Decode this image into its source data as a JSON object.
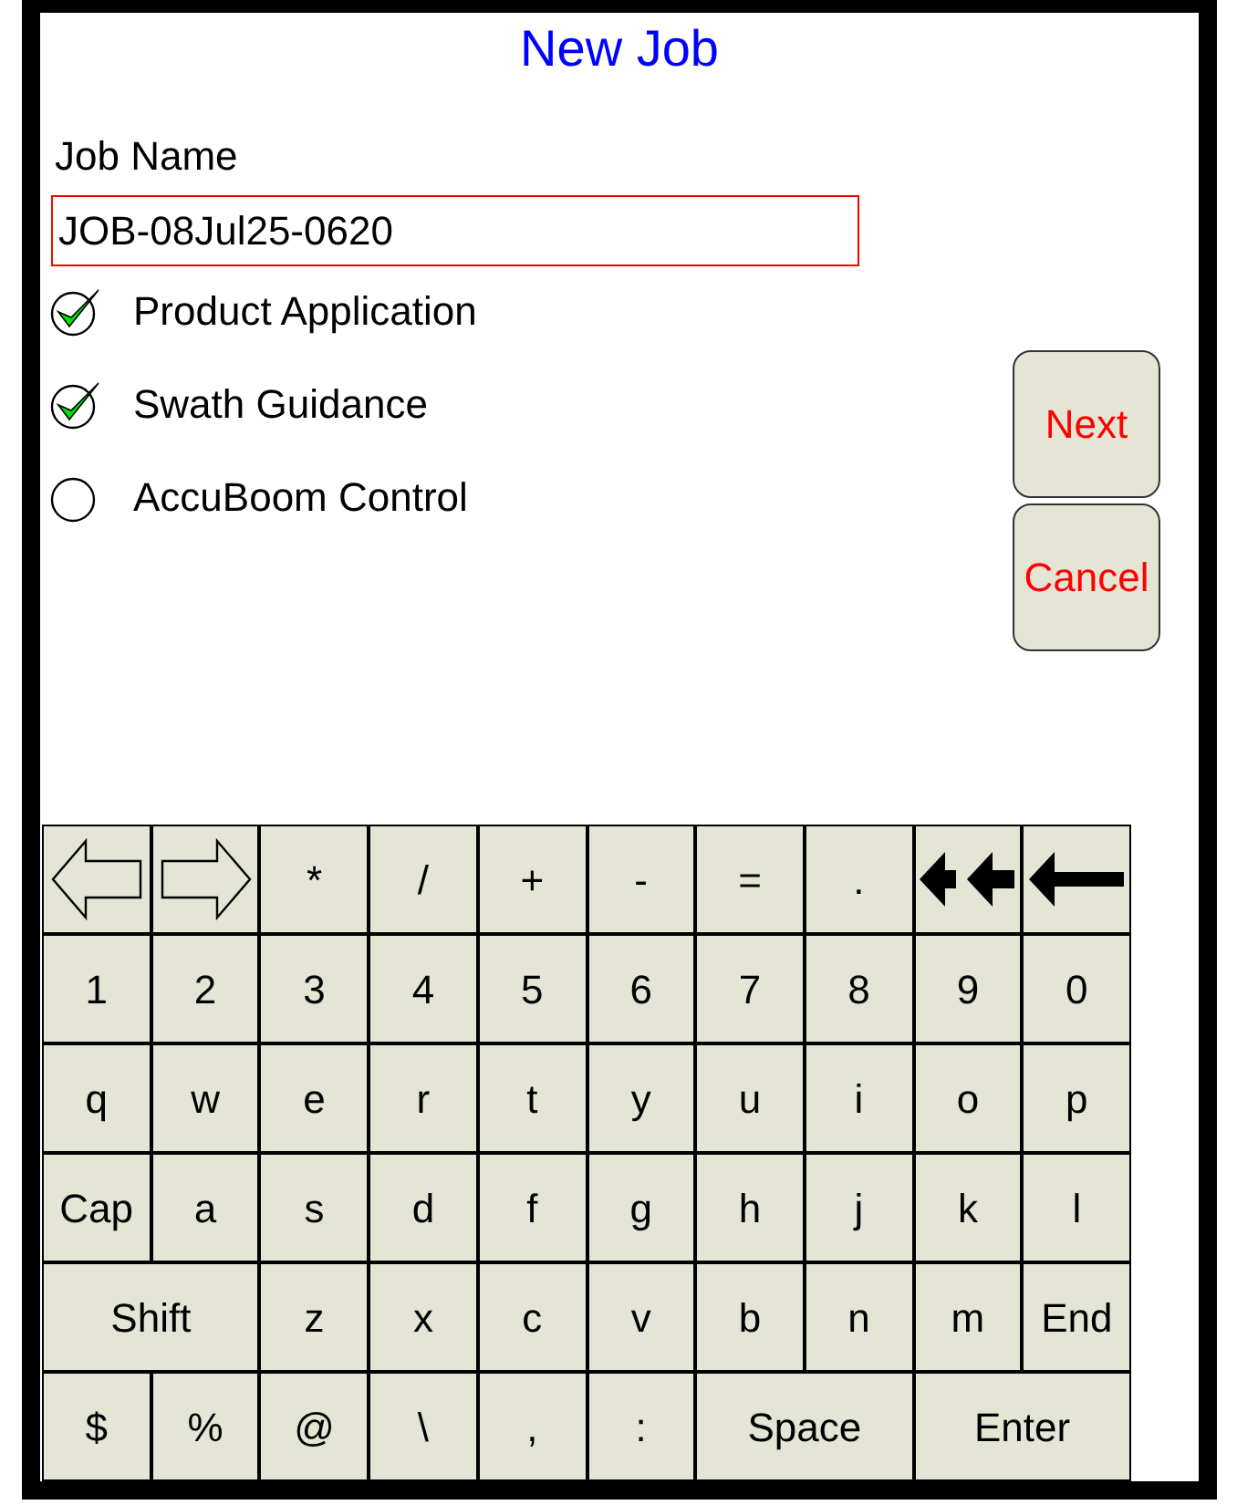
{
  "title": "New Job",
  "job_name": {
    "label": "Job Name",
    "value": "JOB-08Jul25-0620"
  },
  "options": [
    {
      "label": "Product Application",
      "checked": true
    },
    {
      "label": "Swath Guidance",
      "checked": true
    },
    {
      "label": "AccuBoom Control",
      "checked": false
    }
  ],
  "buttons": [
    "Next",
    "Cancel"
  ],
  "keyboard": [
    [
      {
        "kind": "left-arrow"
      },
      {
        "kind": "right-arrow"
      },
      {
        "kind": "key",
        "label": "*"
      },
      {
        "kind": "key",
        "label": "/"
      },
      {
        "kind": "key",
        "label": "+"
      },
      {
        "kind": "key",
        "label": "-"
      },
      {
        "kind": "key",
        "label": "="
      },
      {
        "kind": "key",
        "label": "."
      },
      {
        "kind": "clear"
      },
      {
        "kind": "backspace"
      }
    ],
    [
      {
        "kind": "key",
        "label": "1"
      },
      {
        "kind": "key",
        "label": "2"
      },
      {
        "kind": "key",
        "label": "3"
      },
      {
        "kind": "key",
        "label": "4"
      },
      {
        "kind": "key",
        "label": "5"
      },
      {
        "kind": "key",
        "label": "6"
      },
      {
        "kind": "key",
        "label": "7"
      },
      {
        "kind": "key",
        "label": "8"
      },
      {
        "kind": "key",
        "label": "9"
      },
      {
        "kind": "key",
        "label": "0"
      }
    ],
    [
      {
        "kind": "key",
        "label": "q"
      },
      {
        "kind": "key",
        "label": "w"
      },
      {
        "kind": "key",
        "label": "e"
      },
      {
        "kind": "key",
        "label": "r"
      },
      {
        "kind": "key",
        "label": "t"
      },
      {
        "kind": "key",
        "label": "y"
      },
      {
        "kind": "key",
        "label": "u"
      },
      {
        "kind": "key",
        "label": "i"
      },
      {
        "kind": "key",
        "label": "o"
      },
      {
        "kind": "key",
        "label": "p"
      }
    ],
    [
      {
        "kind": "key",
        "label": "Cap"
      },
      {
        "kind": "key",
        "label": "a"
      },
      {
        "kind": "key",
        "label": "s"
      },
      {
        "kind": "key",
        "label": "d"
      },
      {
        "kind": "key",
        "label": "f"
      },
      {
        "kind": "key",
        "label": "g"
      },
      {
        "kind": "key",
        "label": "h"
      },
      {
        "kind": "key",
        "label": "j"
      },
      {
        "kind": "key",
        "label": "k"
      },
      {
        "kind": "key",
        "label": "l"
      }
    ],
    [
      {
        "kind": "wide",
        "label": "Shift"
      },
      {
        "kind": "key",
        "label": "z"
      },
      {
        "kind": "key",
        "label": "x"
      },
      {
        "kind": "key",
        "label": "c"
      },
      {
        "kind": "key",
        "label": "v"
      },
      {
        "kind": "key",
        "label": "b"
      },
      {
        "kind": "key",
        "label": "n"
      },
      {
        "kind": "key",
        "label": "m"
      },
      {
        "kind": "key",
        "label": "End"
      }
    ],
    [
      {
        "kind": "key",
        "label": "$"
      },
      {
        "kind": "key",
        "label": "%"
      },
      {
        "kind": "key",
        "label": "@"
      },
      {
        "kind": "key",
        "label": "\\"
      },
      {
        "kind": "key",
        "label": ","
      },
      {
        "kind": "key",
        "label": ":"
      },
      {
        "kind": "wide",
        "label": "Space"
      },
      {
        "kind": "wide",
        "label": "Enter"
      }
    ]
  ]
}
